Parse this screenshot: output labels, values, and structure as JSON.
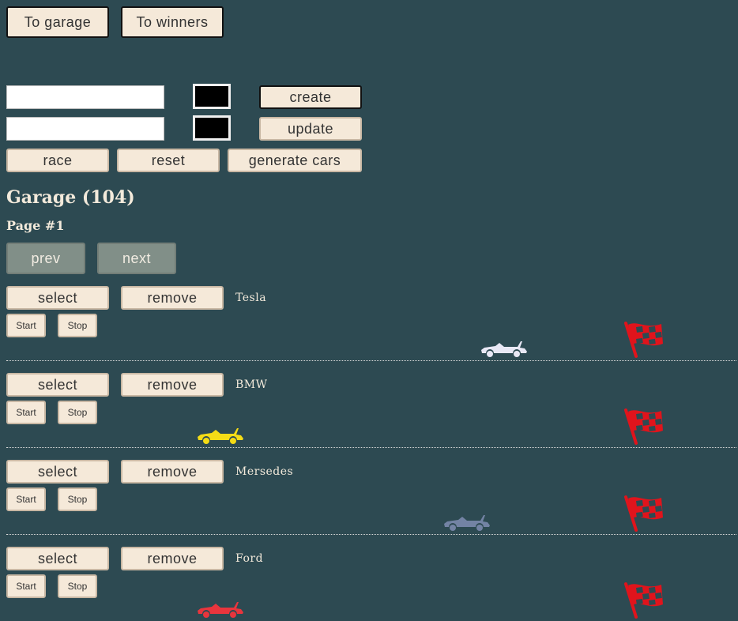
{
  "nav": {
    "garage_label": "To garage",
    "winners_label": "To winners"
  },
  "create": {
    "name_value": "",
    "color": "#000000",
    "button_label": "create"
  },
  "update": {
    "name_value": "",
    "color": "#000000",
    "button_label": "update"
  },
  "controls": {
    "race_label": "race",
    "reset_label": "reset",
    "generate_label": "generate cars"
  },
  "garage": {
    "title": "Garage (104)",
    "page": "Page #1"
  },
  "pagination": {
    "prev_label": "prev",
    "next_label": "next"
  },
  "car_controls": {
    "select_label": "select",
    "remove_label": "remove",
    "start_label": "Start",
    "stop_label": "Stop"
  },
  "cars": [
    {
      "name": "Tesla",
      "color": "#e8e8f5",
      "icon": "car-icon"
    },
    {
      "name": "BMW",
      "color": "#f5dc16",
      "icon": "car-icon"
    },
    {
      "name": "Mersedes",
      "color": "#7383a4",
      "icon": "car-icon"
    },
    {
      "name": "Ford",
      "color": "#e8353d",
      "icon": "car-icon"
    }
  ],
  "finish_flag": {
    "icon": "checkered-flag-icon",
    "color": "#e0141c"
  }
}
